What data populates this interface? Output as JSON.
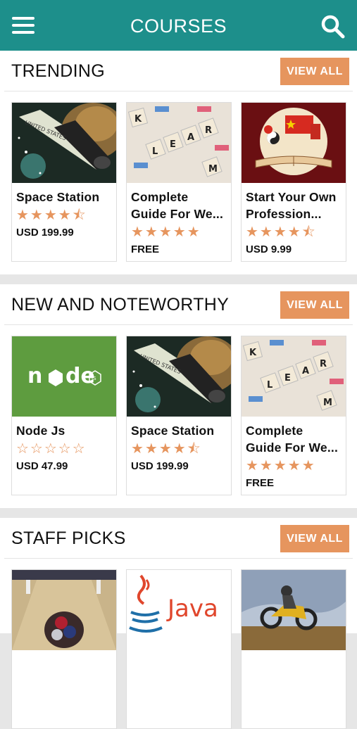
{
  "header": {
    "title": "COURSES"
  },
  "sections": [
    {
      "title": "TRENDING",
      "button": "VIEW ALL",
      "cards": [
        {
          "name": "Space Station",
          "stars": "★★★★⯪",
          "price": "USD 199.99",
          "image": "space-station"
        },
        {
          "name": "Complete Guide For We...",
          "stars": "★★★★★",
          "price": "FREE",
          "image": "learn-tiles"
        },
        {
          "name": "Start Your Own Profession...",
          "stars": "★★★★⯪",
          "price": "USD 9.99",
          "image": "china-book"
        }
      ]
    },
    {
      "title": "NEW AND NOTEWORTHY",
      "button": "VIEW ALL",
      "cards": [
        {
          "name": "Node Js",
          "stars": "☆☆☆☆☆",
          "price": "USD 47.99",
          "image": "node-logo"
        },
        {
          "name": "Space Station",
          "stars": "★★★★⯪",
          "price": "USD 199.99",
          "image": "space-station"
        },
        {
          "name": "Complete Guide For We...",
          "stars": "★★★★★",
          "price": "FREE",
          "image": "learn-tiles"
        }
      ]
    },
    {
      "title": "STAFF PICKS",
      "button": "VIEW ALL",
      "cards": [
        {
          "name": "",
          "stars": "",
          "price": "",
          "image": "bowling"
        },
        {
          "name": "",
          "stars": "",
          "price": "",
          "image": "java-logo"
        },
        {
          "name": "",
          "stars": "",
          "price": "",
          "image": "motocross"
        }
      ]
    }
  ],
  "colors": {
    "appbar": "#1d8f8b",
    "accent": "#e6955e"
  }
}
